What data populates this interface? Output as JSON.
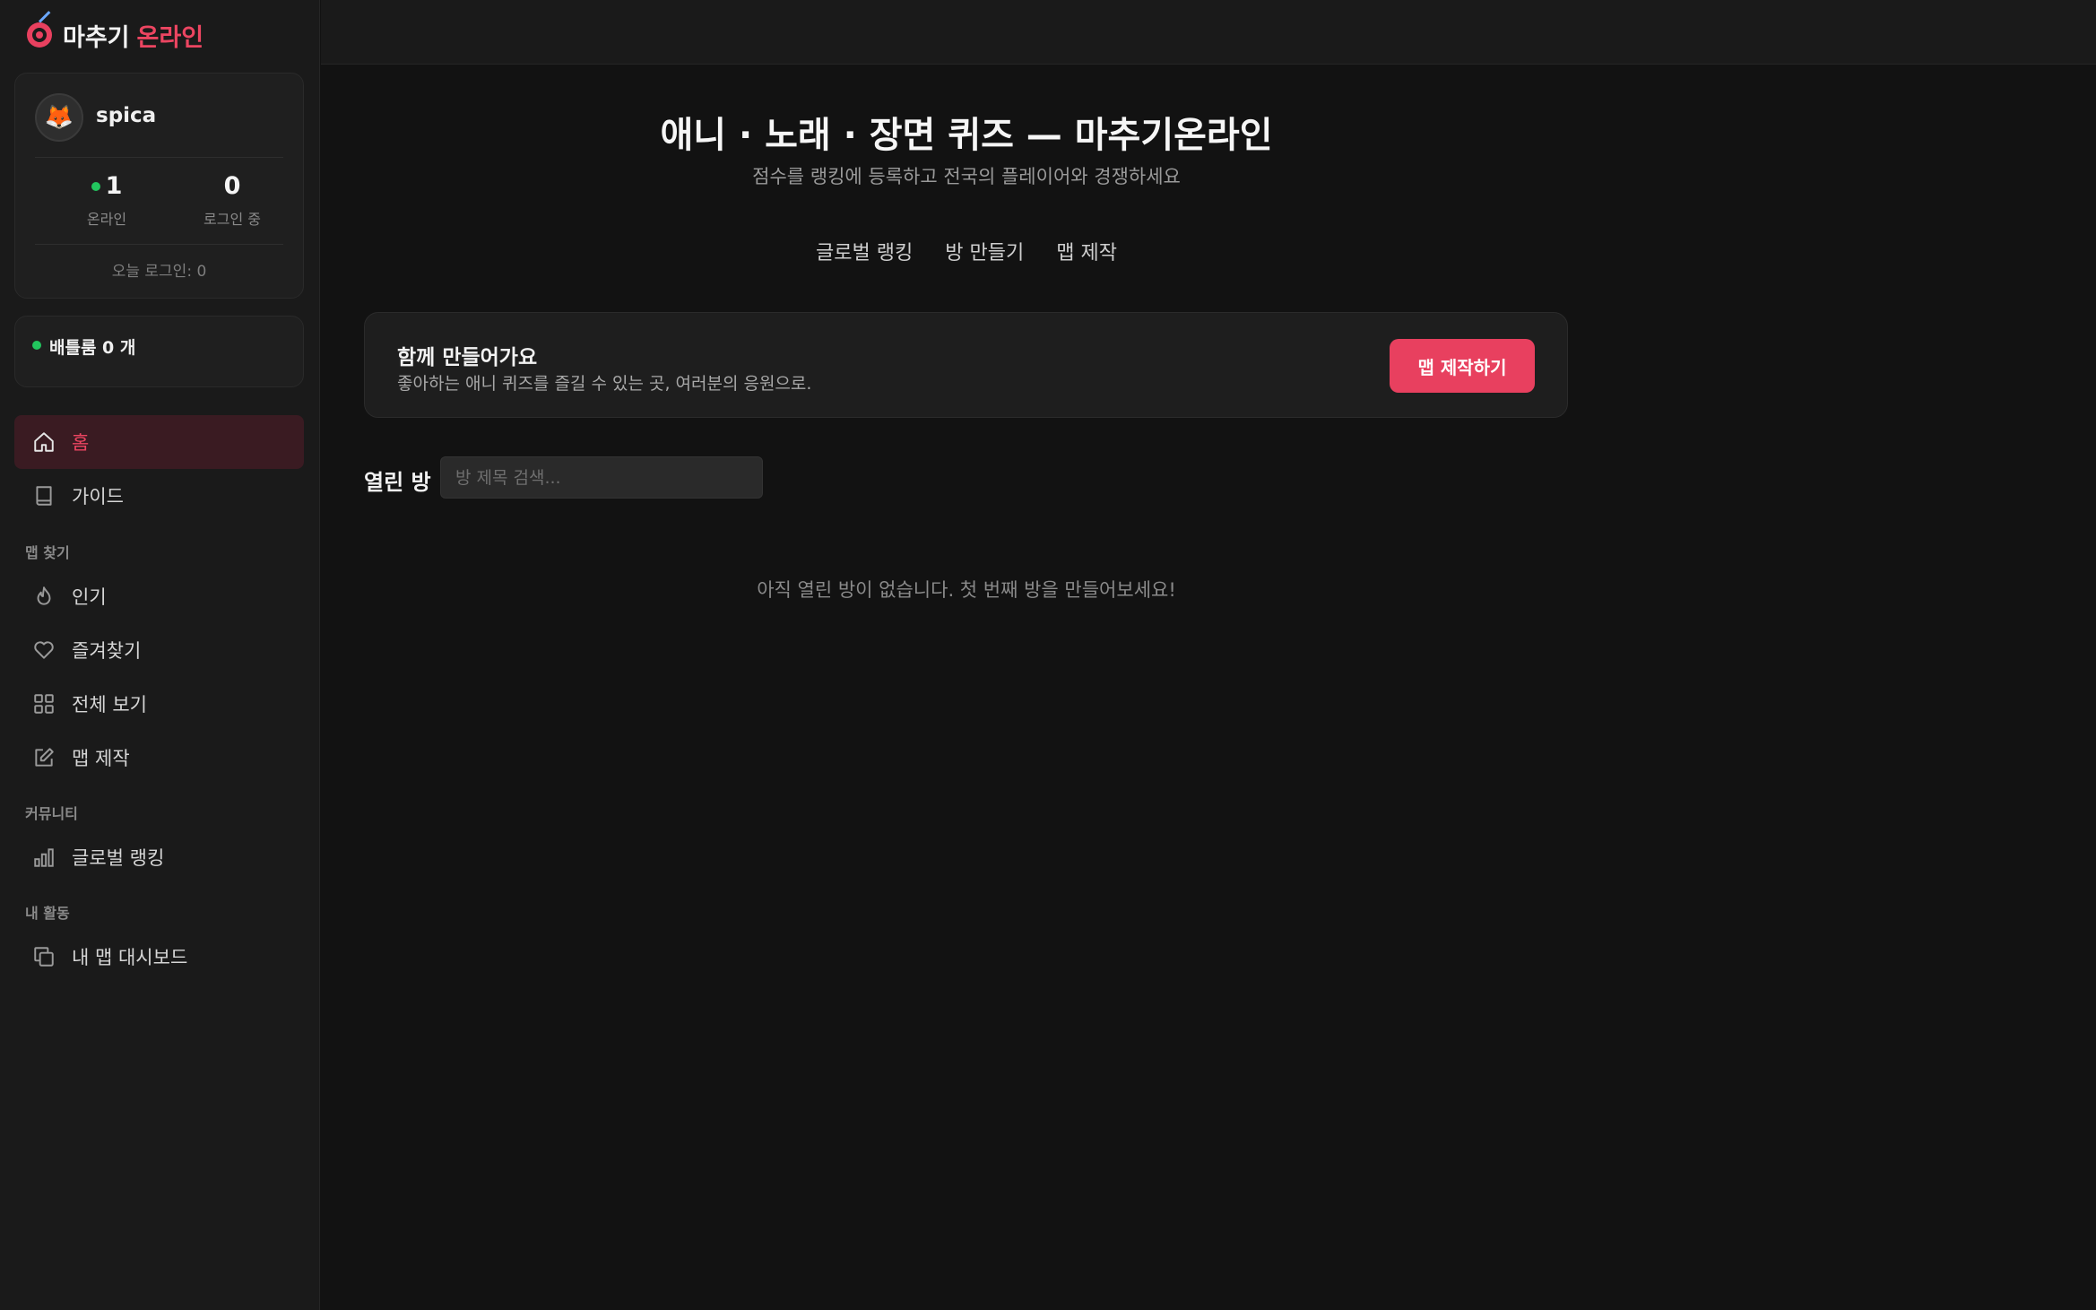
{
  "brand": {
    "part1": "마추기",
    "part2": "온라인"
  },
  "profile": {
    "avatar_emoji": "🦊",
    "username": "spica",
    "online_count": "1",
    "online_label": "온라인",
    "logged_in_count": "0",
    "logged_in_label": "로그인 중",
    "today_login": "오늘 로그인: 0"
  },
  "battle_rooms": {
    "label": "배틀룸 0 개"
  },
  "nav": {
    "home": "홈",
    "guide": "가이드",
    "section_find": "맵 찾기",
    "popular": "인기",
    "favorites": "즐겨찾기",
    "view_all": "전체 보기",
    "map_create": "맵 제작",
    "section_community": "커뮤니티",
    "global_ranking": "글로벌 랭킹",
    "section_my": "내 활동",
    "my_dashboard": "내 맵 대시보드"
  },
  "hero": {
    "title": "애니 · 노래 · 장면 퀴즈 — 마추기온라인",
    "subtitle": "점수를 랭킹에 등록하고 전국의 플레이어와 경쟁하세요"
  },
  "tabs": [
    "글로벌 랭킹",
    "방 만들기",
    "맵 제작"
  ],
  "promo": {
    "title": "함께 만들어가요",
    "desc": "좋아하는 애니 퀴즈를 즐길 수 있는 곳, 여러분의 응원으로.",
    "button": "맵 제작하기"
  },
  "rooms": {
    "label": "열린 방",
    "search_placeholder": "방 제목 검색...",
    "empty": "아직 열린 방이 없습니다. 첫 번째 방을 만들어보세요!"
  },
  "colors": {
    "accent": "#e8405f",
    "online": "#22c55e",
    "background": "#121212",
    "sidebar": "#1a1a1a"
  }
}
